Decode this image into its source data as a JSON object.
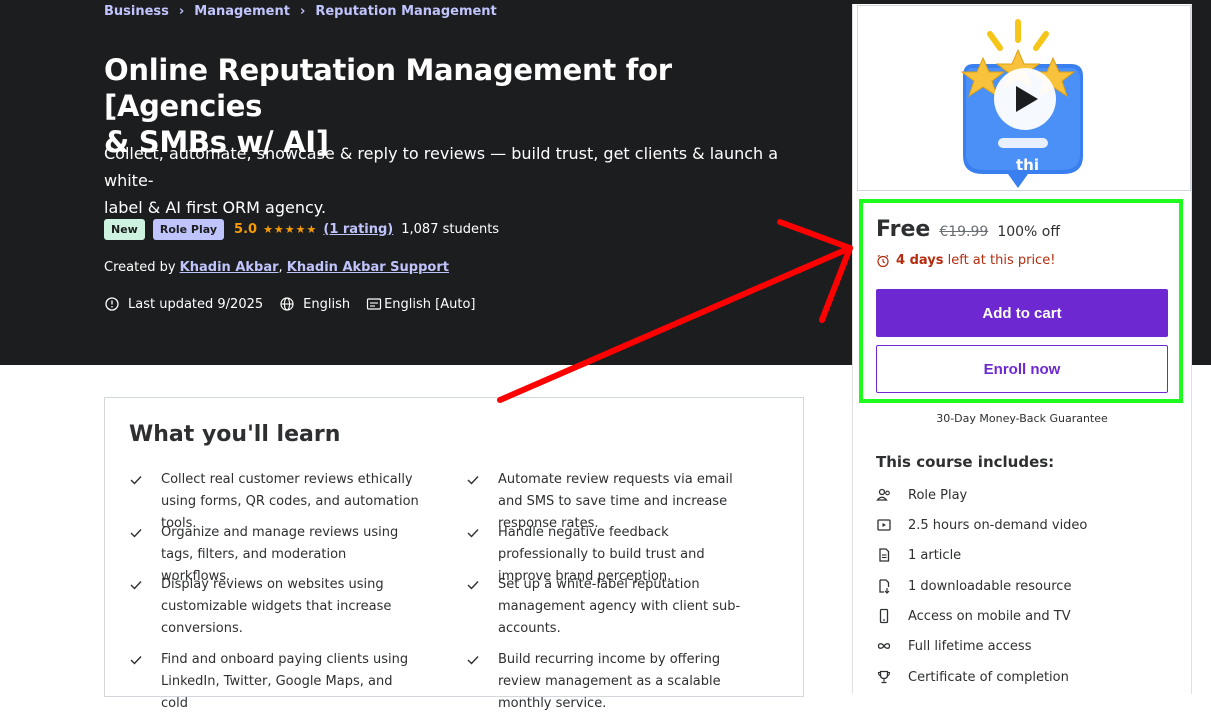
{
  "breadcrumb": [
    "Business",
    "Management",
    "Reputation Management"
  ],
  "course": {
    "title_line1": "Online Reputation Management for [Agencies",
    "title_line2": "& SMBs w/ AI]",
    "subtitle_line1": "Collect, automate, showcase & reply to reviews — build trust, get clients & launch a white-",
    "subtitle_line2": "label & AI first ORM agency.",
    "badge_new": "New",
    "badge_role": "Role Play",
    "rating": "5.0",
    "stars": "★★★★★",
    "rating_count": "(1 rating)",
    "students": "1,087 students",
    "created_by": "Created by",
    "author1": "Khadin Akbar",
    "author_sep": ",",
    "author2": "Khadin Akbar Support",
    "last_updated": "Last updated 9/2025",
    "language": "English",
    "captions": "English [Auto]"
  },
  "learn": {
    "heading": "What you'll learn",
    "items": [
      "Collect real customer reviews ethically using forms, QR codes, and automation tools.",
      "Automate review requests via email and SMS to save time and increase response rates.",
      "Organize and manage reviews using tags, filters, and moderation workflows.",
      "Handle negative feedback professionally to build trust and improve brand perception.",
      "Display reviews on websites using customizable widgets that increase conversions.",
      "Set up a white-label reputation management agency with client sub-accounts.",
      "Find and onboard paying clients using LinkedIn, Twitter, Google Maps, and cold",
      "Build recurring income by offering review management as a scalable monthly service."
    ]
  },
  "sidebar": {
    "preview_text": "thi",
    "price": "Free",
    "old_price": "€19.99",
    "discount": "100% off",
    "timer_bold": "4 days",
    "timer_rest": "left at this price!",
    "add_to_cart": "Add to cart",
    "enroll_now": "Enroll now",
    "guarantee": "30-Day Money-Back Guarantee",
    "includes_title": "This course includes:",
    "includes": [
      {
        "icon": "role-play-icon",
        "label": "Role Play"
      },
      {
        "icon": "video-icon",
        "label": "2.5 hours on-demand video"
      },
      {
        "icon": "article-icon",
        "label": "1 article"
      },
      {
        "icon": "download-icon",
        "label": "1 downloadable resource"
      },
      {
        "icon": "mobile-icon",
        "label": "Access on mobile and TV"
      },
      {
        "icon": "infinity-icon",
        "label": "Full lifetime access"
      },
      {
        "icon": "trophy-icon",
        "label": "Certificate of completion"
      }
    ]
  },
  "colors": {
    "hero_bg": "#1c1d1f",
    "accent_purple": "#6d28d2",
    "link_lavender": "#c0c4fc",
    "star_orange": "#f69c08",
    "timer_red": "#b32d0f",
    "highlight_green": "#1efc1e",
    "arrow_red": "#ff0000"
  }
}
